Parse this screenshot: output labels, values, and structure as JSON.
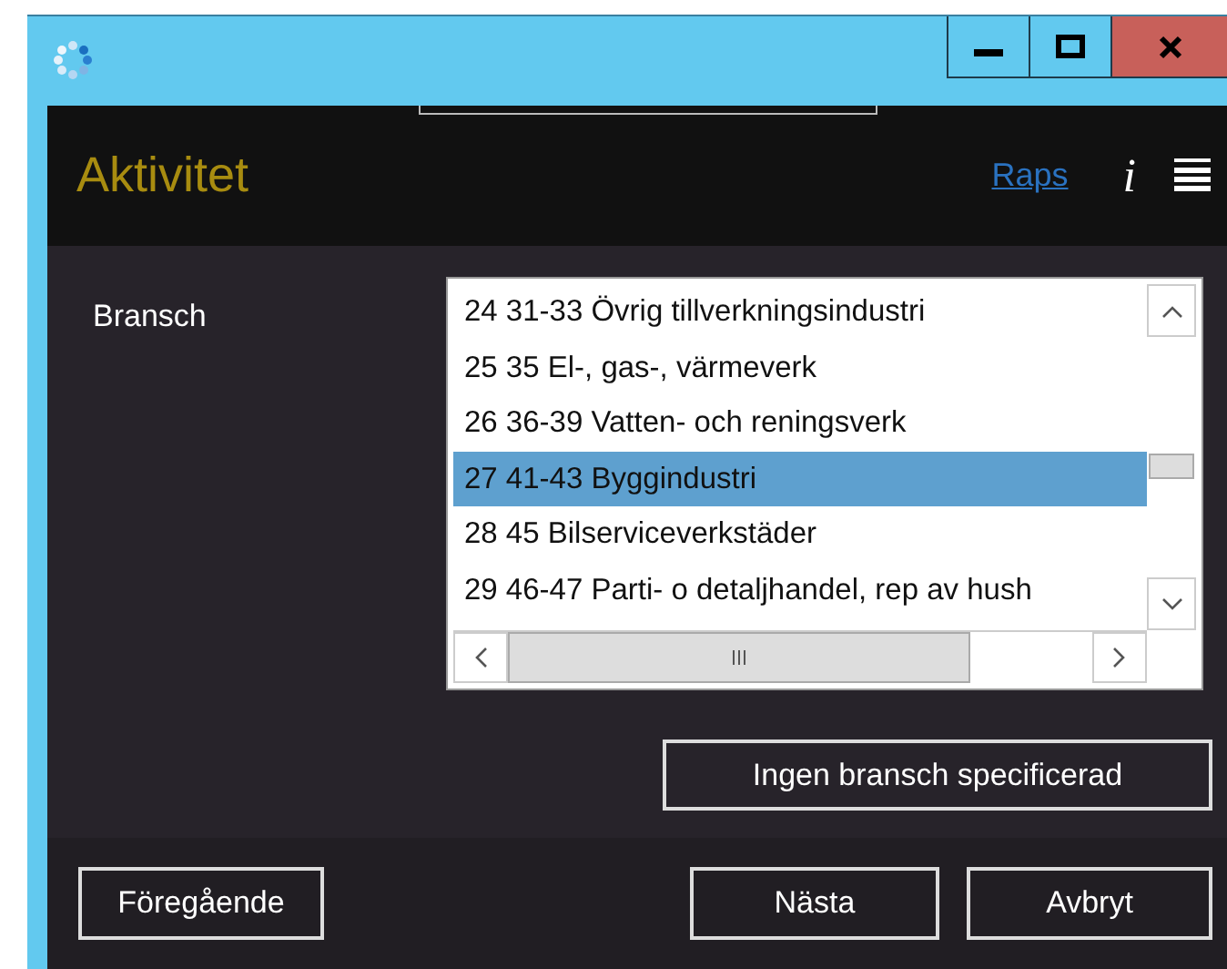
{
  "header": {
    "title": "Aktivitet",
    "link": "Raps",
    "info": "i"
  },
  "form": {
    "label": "Bransch",
    "options": [
      {
        "text": "24 31-33 Övrig tillverkningsindustri",
        "selected": false
      },
      {
        "text": "25 35 El-, gas-, värmeverk",
        "selected": false
      },
      {
        "text": "26 36-39 Vatten- och reningsverk",
        "selected": false
      },
      {
        "text": "27 41-43 Byggindustri",
        "selected": true
      },
      {
        "text": "28 45 Bilserviceverkstäder",
        "selected": false
      },
      {
        "text": "29 46-47 Parti- o detaljhandel, rep av hush",
        "selected": false
      }
    ],
    "clear_button": "Ingen bransch specificerad"
  },
  "footer": {
    "back": "Föregående",
    "next": "Nästa",
    "cancel": "Avbryt"
  }
}
